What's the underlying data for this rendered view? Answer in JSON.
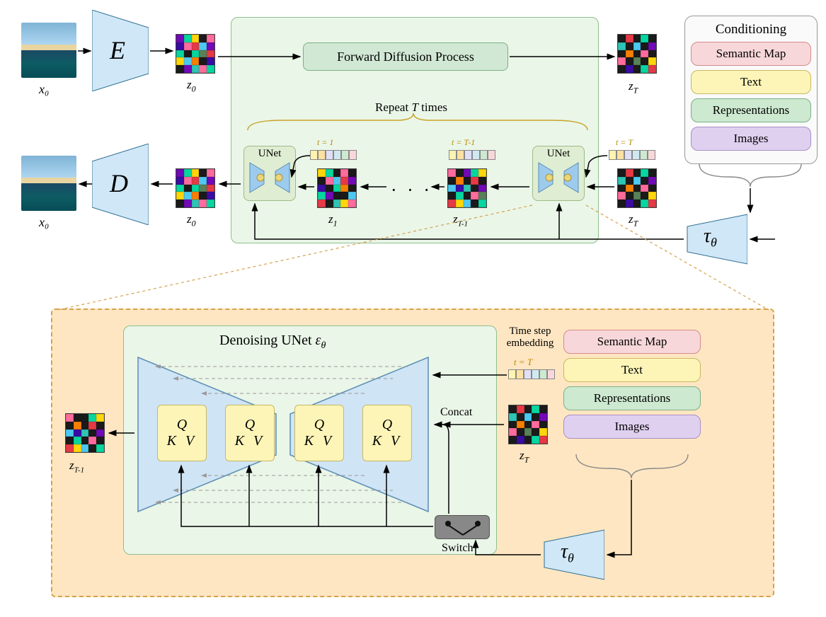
{
  "top": {
    "input_label": "x₀",
    "encoder_label": "E",
    "z0_label": "z₀",
    "forward_process": "Forward Diffusion Process",
    "zt_label_right": "z_T",
    "repeat_label": "Repeat T times",
    "unet_label": "UNet",
    "z1_label": "z₁",
    "zt1_label": "z_{T-1}",
    "ts_1": "t = 1",
    "ts_T1": "t = T-1",
    "ts_T": "t = T",
    "decoder_label": "D",
    "output_label": "x₀",
    "tau_label": "τ_θ"
  },
  "conditioning": {
    "title": "Conditioning",
    "sem": "Semantic Map",
    "txt": "Text",
    "rep": "Representations",
    "img": "Images"
  },
  "detail": {
    "title": "Denoising UNet ε_θ",
    "timestep_label": "Time step embedding",
    "ts_T": "t = T",
    "concat": "Concat",
    "switch": "Switch",
    "zt": "z_T",
    "zt1": "z_{T-1}",
    "q": "Q",
    "kv": "K V",
    "tau": "τ_θ"
  }
}
